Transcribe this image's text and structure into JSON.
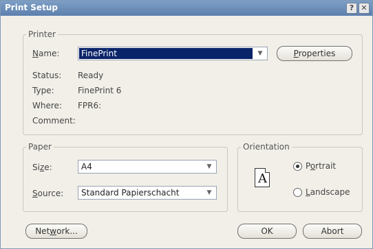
{
  "window": {
    "title": "Print Setup",
    "help_glyph": "?",
    "close_glyph": "✕"
  },
  "printer": {
    "group_label": "Printer",
    "name_label_prefix": "",
    "name_label_u": "N",
    "name_label_rest": "ame:",
    "name_value": "FinePrint",
    "properties_u": "P",
    "properties_rest": "roperties",
    "status_label": "Status:",
    "status_value": "Ready",
    "type_label": "Type:",
    "type_value": "FinePrint 6",
    "where_label": "Where:",
    "where_value": "FPR6:",
    "comment_label": "Comment:",
    "comment_value": ""
  },
  "paper": {
    "group_label": "Paper",
    "size_label_prefix": "Si",
    "size_label_u": "z",
    "size_label_rest": "e:",
    "size_value": "A4",
    "source_label_prefix": "",
    "source_label_u": "S",
    "source_label_rest": "ource:",
    "source_value": "Standard Papierschacht"
  },
  "orientation": {
    "group_label": "Orientation",
    "doc_letter": "A",
    "portrait_prefix": "P",
    "portrait_u": "o",
    "portrait_rest": "rtrait",
    "landscape_prefix": "",
    "landscape_u": "L",
    "landscape_rest": "andscape",
    "selected": "portrait"
  },
  "buttons": {
    "network_prefix": "Net",
    "network_u": "w",
    "network_rest": "ork...",
    "ok": "OK",
    "abort": "Abort"
  },
  "icons": {
    "dropdown": "▼"
  }
}
